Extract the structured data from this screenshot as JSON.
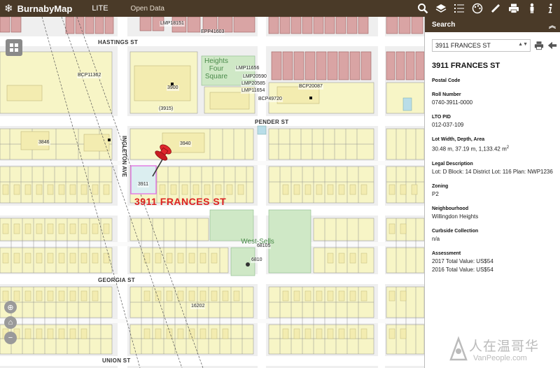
{
  "topbar": {
    "brand_icon": "snowflake-icon",
    "brand_title": "BurnabyMap",
    "nav_lite": "LITE",
    "nav_open_data": "Open Data",
    "tools": [
      {
        "name": "search-tool-icon",
        "icon": "search-icon"
      },
      {
        "name": "layers-tool-icon",
        "icon": "layers-icon"
      },
      {
        "name": "legend-tool-icon",
        "icon": "list-icon"
      },
      {
        "name": "basemap-tool-icon",
        "icon": "palette-icon"
      },
      {
        "name": "measure-tool-icon",
        "icon": "ruler-icon"
      },
      {
        "name": "print-tool-icon",
        "icon": "printer-icon"
      },
      {
        "name": "streetview-tool-icon",
        "icon": "person-icon"
      },
      {
        "name": "info-tool-icon",
        "icon": "info-icon"
      }
    ]
  },
  "map": {
    "streets": {
      "hastings": "HASTINGS ST",
      "pender": "PENDER ST",
      "georgia": "GEORGIA ST",
      "union": "UNION ST",
      "ingleton": "INGLETON AVE"
    },
    "parks": {
      "heights": "Heights\nFour\nSquare",
      "west_sells": "West-Sells"
    },
    "selected_address": "3911 FRANCES ST",
    "labels": {
      "lmp_top": "LMP18151",
      "epp_top": "EPP41603",
      "bcp_left": "BCP11362",
      "lmp11656": "LMP11656",
      "lmp20590": "LMP20590",
      "lmp20585": "LMP20585",
      "lmp11654": "LMP11654",
      "bcp20087": "BCP20087",
      "bcp49720": "BCP49720",
      "lmp_west_sells_1": "68105",
      "lmp_west_sells_2": "6810",
      "p16202": "16202",
      "lot_3900": "3900",
      "lot_3940": "3940",
      "lot_3846": "3846",
      "lot_3915": "(3915)",
      "lot_3911": "3911"
    }
  },
  "panel": {
    "header": "Search",
    "search_value": "3911 FRANCES ST",
    "result_title": "3911 FRANCES ST",
    "fields": [
      {
        "label": "Postal Code",
        "value": ""
      },
      {
        "label": "Roll Number",
        "value": "0740-3911-0000"
      },
      {
        "label": "LTO PID",
        "value": "012-037-109"
      },
      {
        "label": "Lot Width, Depth, Area",
        "value": "30.48 m, 37.19 m, 1,133.42 m"
      },
      {
        "label": "Legal Description",
        "value": "Lot: D Block: 14 District Lot: 116 Plan: NWP1236"
      },
      {
        "label": "Zoning",
        "value": "P2"
      },
      {
        "label": "Neighbourhood",
        "value": "Willingdon Heights"
      },
      {
        "label": "Curbside Collection",
        "value": "n/a"
      },
      {
        "label": "Assessment",
        "value": "2017 Total Value: US$54"
      },
      {
        "label": "",
        "value": "2016 Total Value: US$54"
      }
    ],
    "area_unit_sup": "2"
  },
  "watermark": {
    "cn": "人在温哥华",
    "en": "VanPeople.com"
  },
  "colors": {
    "topbar": "#4a3a28",
    "parcel_fill": "#f7f6c8",
    "parcel_red": "#d8a0a0",
    "park_green": "#c8e6c0",
    "selection_magenta": "#e36ee3",
    "pin_red": "#e0262b"
  }
}
